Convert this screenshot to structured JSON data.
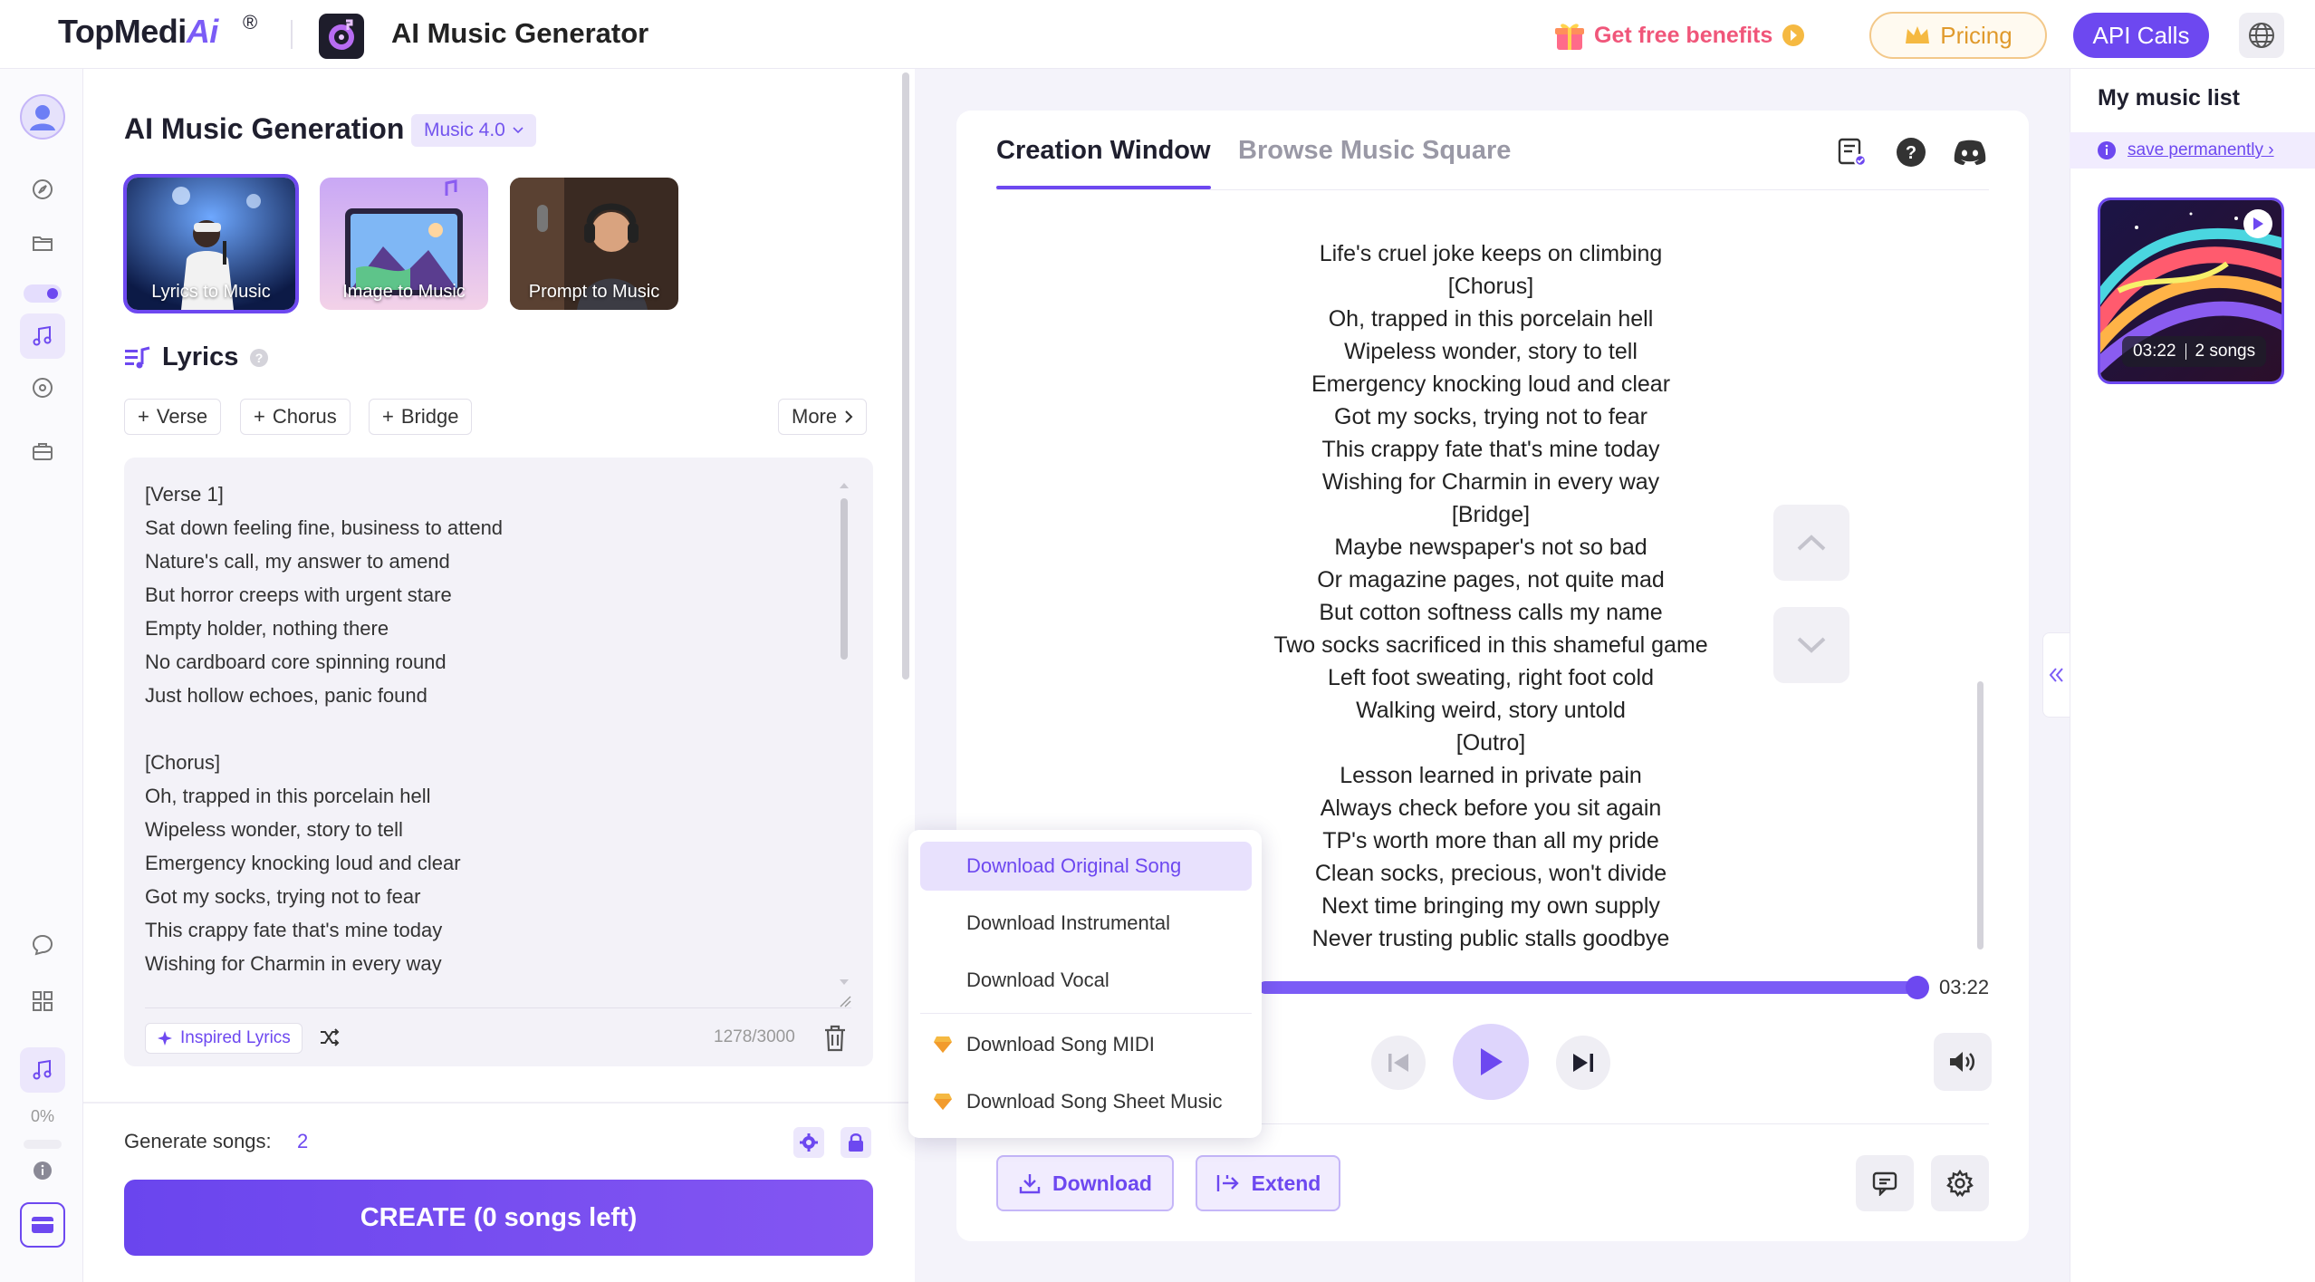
{
  "header": {
    "brand": "TopMedi",
    "brand_ai": "Ai",
    "brand_reg": "®",
    "app_title": "AI Music Generator",
    "benefits_label": "Get free benefits",
    "pricing_label": "Pricing",
    "api_label": "API Calls"
  },
  "rail": {
    "progress_label": "0%"
  },
  "left": {
    "title": "AI Music Generation",
    "version": "Music 4.0",
    "modes": [
      {
        "label": "Lyrics to Music"
      },
      {
        "label": "Image to Music"
      },
      {
        "label": "Prompt to Music"
      }
    ],
    "lyrics_heading": "Lyrics",
    "chips": [
      "Verse",
      "Chorus",
      "Bridge"
    ],
    "more_label": "More",
    "lyrics_text": "[Verse 1]\nSat down feeling fine, business to attend\nNature's call, my answer to amend\nBut horror creeps with urgent stare\nEmpty holder, nothing there\nNo cardboard core spinning round\nJust hollow echoes, panic found\n\n[Chorus]\nOh, trapped in this porcelain hell\nWipeless wonder, story to tell\nEmergency knocking loud and clear\nGot my socks, trying not to fear\nThis crappy fate that's mine today\nWishing for Charmin in every way",
    "inspired_label": "Inspired Lyrics",
    "char_count": "1278/3000",
    "generate_label": "Generate songs:",
    "generate_count": "2",
    "create_label": "CREATE (0 songs left)"
  },
  "center": {
    "tabs": [
      {
        "label": "Creation Window"
      },
      {
        "label": "Browse Music Square"
      }
    ],
    "song_lyrics": [
      "Life's cruel joke keeps on climbing",
      "[Chorus]",
      "Oh, trapped in this porcelain hell",
      "Wipeless wonder, story to tell",
      "Emergency knocking loud and clear",
      "Got my socks, trying not to fear",
      "This crappy fate that's mine today",
      "Wishing for Charmin in every way",
      "[Bridge]",
      "Maybe newspaper's not so bad",
      "Or magazine pages, not quite mad",
      "But cotton softness calls my name",
      "Two socks sacrificed in this shameful game",
      "Left foot sweating, right foot cold",
      "Walking weird, story untold",
      "[Outro]",
      "Lesson learned in private pain",
      "Always check before you sit again",
      "TP's worth more than all my pride",
      "Clean socks, precious, won't divide",
      "Next time bringing my own supply",
      "Never trusting public stalls goodbye"
    ],
    "duration": "03:22",
    "playback_progress": 1.0,
    "download_label": "Download",
    "extend_label": "Extend"
  },
  "download_menu": {
    "items": [
      {
        "label": "Download Original Song",
        "selected": true,
        "premium": false
      },
      {
        "label": "Download Instrumental",
        "selected": false,
        "premium": false
      },
      {
        "label": "Download Vocal",
        "selected": false,
        "premium": false
      },
      {
        "label": "Download Song MIDI",
        "selected": false,
        "premium": true
      },
      {
        "label": "Download Song Sheet Music",
        "selected": false,
        "premium": true
      }
    ]
  },
  "right": {
    "title": "My music list",
    "save_label": "save permanently ›",
    "card": {
      "duration": "03:22",
      "songs": "2 songs"
    }
  },
  "colors": {
    "accent": "#6d48f0",
    "accent_light": "#ece7fc",
    "benefits": "#f0567a",
    "pricing": "#e09a2c",
    "premium_gem": "#f5b942"
  }
}
